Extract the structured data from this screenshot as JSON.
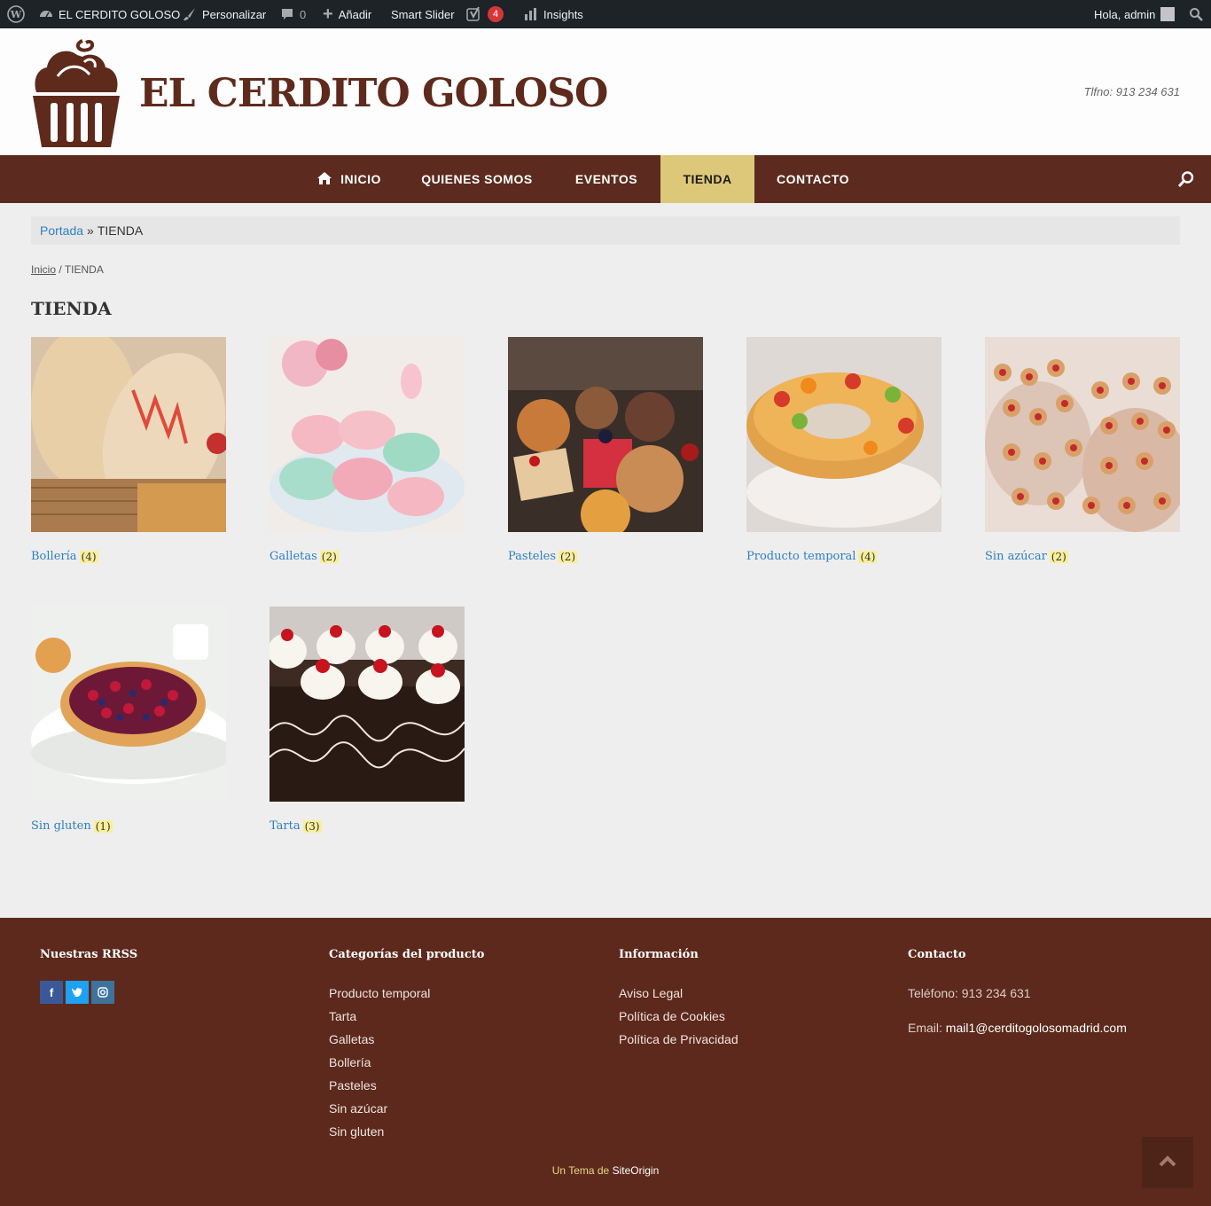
{
  "adminbar": {
    "site_name": "EL CERDITO GOLOSO",
    "customize": "Personalizar",
    "comments_count": "0",
    "add_new": "Añadir",
    "smart_slider": "Smart Slider",
    "yoast_badge": "4",
    "insights": "Insights",
    "greeting": "Hola, admin"
  },
  "header": {
    "site_title": "EL CERDITO GOLOSO",
    "phone": "Tlfno: 913 234 631"
  },
  "nav": {
    "items": [
      "INICIO",
      "QUIENES SOMOS",
      "EVENTOS",
      "TIENDA",
      "CONTACTO"
    ],
    "active": "TIENDA"
  },
  "breadcrumb": {
    "home": "Portada",
    "sep": "»",
    "current": "TIENDA"
  },
  "woo_breadcrumb": {
    "home": "Inicio",
    "sep": "/",
    "current": "TIENDA"
  },
  "page_title": "TIENDA",
  "categories": [
    {
      "name": "Bollería",
      "count": "(4)"
    },
    {
      "name": "Galletas",
      "count": "(2)"
    },
    {
      "name": "Pasteles",
      "count": "(2)"
    },
    {
      "name": "Producto temporal",
      "count": "(4)"
    },
    {
      "name": "Sin azúcar",
      "count": "(2)"
    },
    {
      "name": "Sin gluten",
      "count": "(1)"
    },
    {
      "name": "Tarta",
      "count": "(3)"
    }
  ],
  "footer": {
    "rrss_title": "Nuestras RRSS",
    "categories_title": "Categorías del producto",
    "categories": [
      "Producto temporal",
      "Tarta",
      "Galletas",
      "Bollería",
      "Pasteles",
      "Sin azúcar",
      "Sin gluten"
    ],
    "info_title": "Información",
    "info_links": [
      "Aviso Legal",
      "Política de Cookies",
      "Política de Privacidad"
    ],
    "contact_title": "Contacto",
    "contact_phone": "Teléfono: 913 234 631",
    "contact_email_label": "Email:",
    "contact_email": "mail1@cerditogolosomadrid.com",
    "credit_prefix": "Un Tema de",
    "credit_link": "SiteOrigin"
  },
  "colors": {
    "brand_brown": "#5c2a1e",
    "nav_active": "#dcc878",
    "link_blue": "#2f7fbf",
    "count_highlight": "#f9ef9a"
  }
}
